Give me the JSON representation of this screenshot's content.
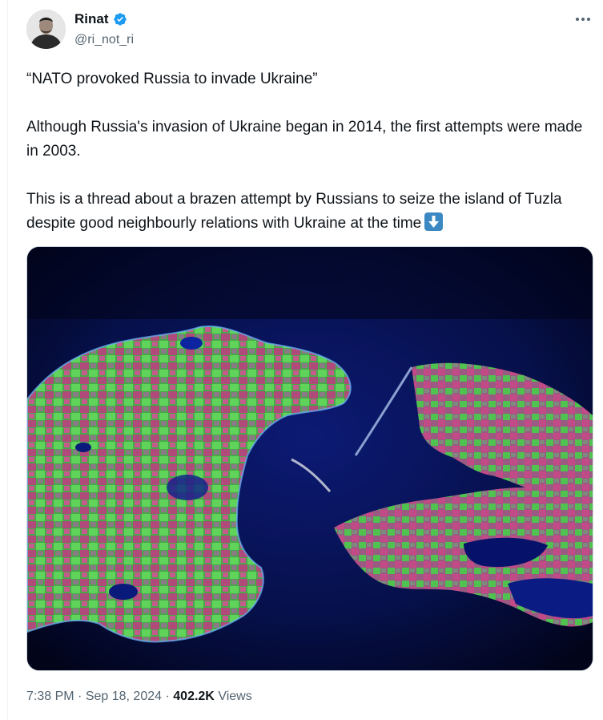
{
  "author": {
    "display_name": "Rinat",
    "handle": "@ri_not_ri",
    "verified": true,
    "verified_color": "#1d9bf0"
  },
  "tweet": {
    "paragraphs": [
      "“NATO provoked Russia to invade Ukraine”",
      "Although Russia's invasion of Ukraine began in 2014, the first attempts were made in 2003.",
      "This is a thread about a brazen attempt by Russians to seize the island of Tuzla despite good neighbourly relations with Ukraine at the time"
    ],
    "trailing_emoji": "down-arrow-emoji"
  },
  "media": {
    "type": "satellite-image",
    "icon": "satellite-map-image"
  },
  "meta": {
    "time": "7:38 PM",
    "separator": "·",
    "date": "Sep 18, 2024",
    "views_count": "402.2K",
    "views_label": "Views"
  },
  "icons": {
    "more": "more-icon",
    "verified": "verified-badge-icon",
    "avatar": "avatar"
  }
}
